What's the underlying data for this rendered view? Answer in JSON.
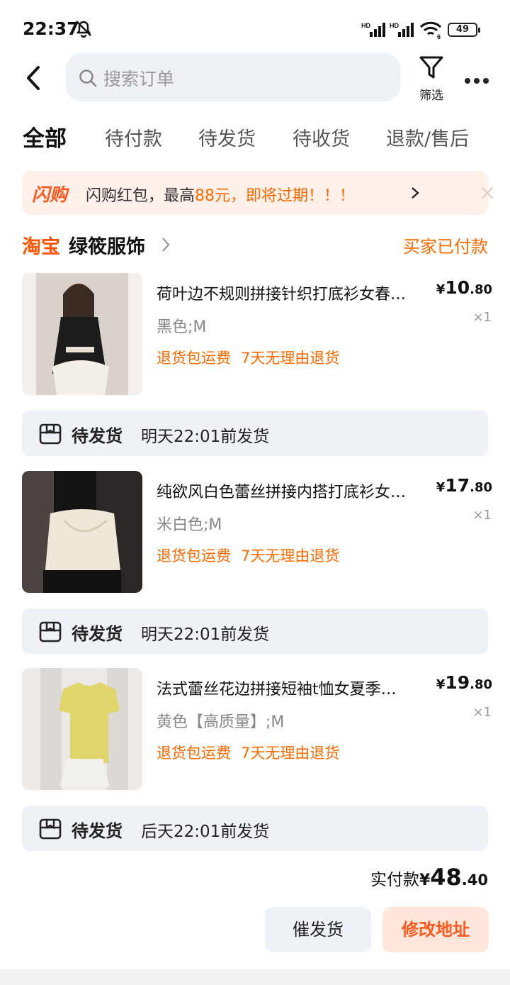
{
  "status_bar": {
    "time": "22:37",
    "signal1": "HD",
    "signal2": "HD",
    "wifi_level": "6",
    "battery": "49"
  },
  "header": {
    "search_placeholder": "搜索订单",
    "filter_label": "筛选"
  },
  "tabs": [
    "全部",
    "待付款",
    "待发货",
    "待收货",
    "退款/售后"
  ],
  "promo": {
    "logo": "闪购",
    "text_before": "闪购红包，最高",
    "amount": "88元",
    "text_after": "，即将过期！！！"
  },
  "shop": {
    "platform": "淘宝",
    "name": "绿筱服饰",
    "order_status": "买家已付款"
  },
  "items": [
    {
      "title": "荷叶边不规则拼接针织打底衫女春…",
      "sku": "黑色;M",
      "price_currency": "¥",
      "price_int": "10",
      "price_dec": ".80",
      "qty": "×1",
      "tags": [
        "退货包运费",
        "7天无理由退货"
      ],
      "ship_status": "待发货",
      "ship_time": "明天22:01前发货"
    },
    {
      "title": "纯欲风白色蕾丝拼接内搭打底衫女…",
      "sku": "米白色;M",
      "price_currency": "¥",
      "price_int": "17",
      "price_dec": ".80",
      "qty": "×1",
      "tags": [
        "退货包运费",
        "7天无理由退货"
      ],
      "ship_status": "待发货",
      "ship_time": "明天22:01前发货"
    },
    {
      "title": "法式蕾丝花边拼接短袖t恤女夏季…",
      "sku": "黄色【高质量】;M",
      "price_currency": "¥",
      "price_int": "19",
      "price_dec": ".80",
      "qty": "×1",
      "tags": [
        "退货包运费",
        "7天无理由退货"
      ],
      "ship_status": "待发货",
      "ship_time": "后天22:01前发货"
    }
  ],
  "total": {
    "label": "实付款",
    "currency": "¥",
    "int": "48",
    "dec": ".40"
  },
  "actions": {
    "urge": "催发货",
    "change_address": "修改地址"
  },
  "colors": {
    "accent": "#ff6a00",
    "panel": "#eef1f6",
    "promo_bg": "#fff0ea"
  }
}
